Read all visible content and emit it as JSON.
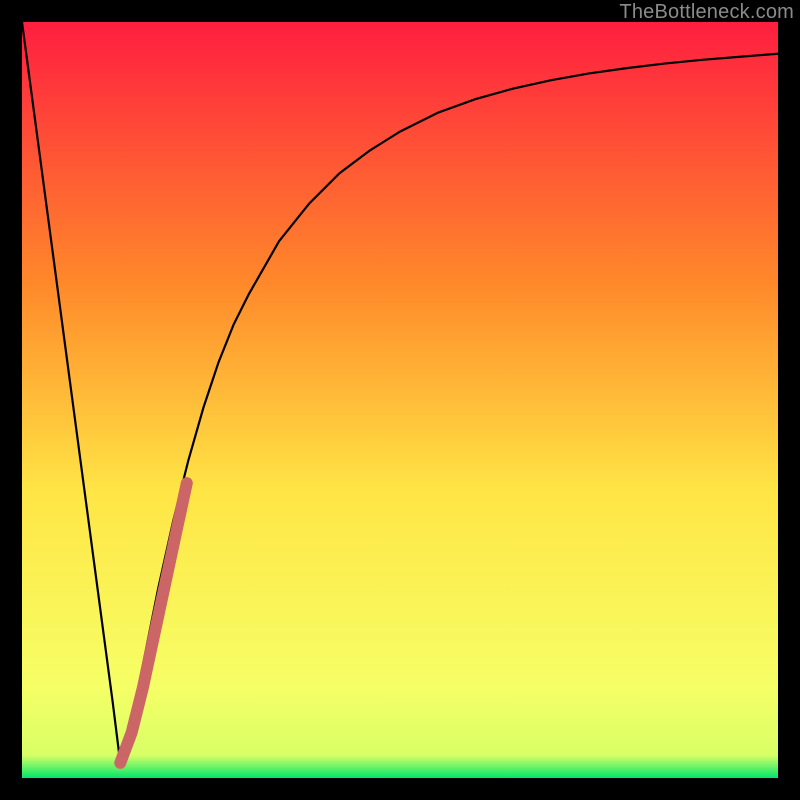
{
  "watermark": "TheBottleneck.com",
  "colors": {
    "background": "#000000",
    "gradient_top": "#ff1e40",
    "gradient_mid_upper": "#ff8a2a",
    "gradient_mid": "#ffe545",
    "gradient_lower": "#f6ff66",
    "gradient_base": "#00e76a",
    "curve": "#000000",
    "marker": "#cc6666"
  },
  "chart_data": {
    "type": "line",
    "title": "",
    "xlabel": "",
    "ylabel": "",
    "xlim": [
      0,
      100
    ],
    "ylim": [
      0,
      100
    ],
    "grid": false,
    "legend": false,
    "series": [
      {
        "name": "bottleneck-curve",
        "x": [
          0,
          2,
          4,
          6,
          8,
          10,
          12,
          13,
          14,
          16,
          18,
          20,
          22,
          24,
          26,
          28,
          30,
          34,
          38,
          42,
          46,
          50,
          55,
          60,
          65,
          70,
          75,
          80,
          85,
          90,
          95,
          100
        ],
        "y": [
          100,
          85,
          70,
          55,
          40,
          25,
          10,
          2,
          5,
          15,
          25,
          34,
          42,
          49,
          55,
          60,
          64,
          71,
          76,
          80,
          83,
          85.5,
          88,
          89.8,
          91.2,
          92.3,
          93.2,
          93.9,
          94.5,
          95,
          95.4,
          95.8
        ]
      },
      {
        "name": "highlight-segment",
        "x": [
          13,
          14.5,
          16,
          17.5,
          19,
          20.5,
          21.8
        ],
        "y": [
          2,
          6,
          12,
          19,
          26,
          33,
          39
        ]
      }
    ]
  }
}
